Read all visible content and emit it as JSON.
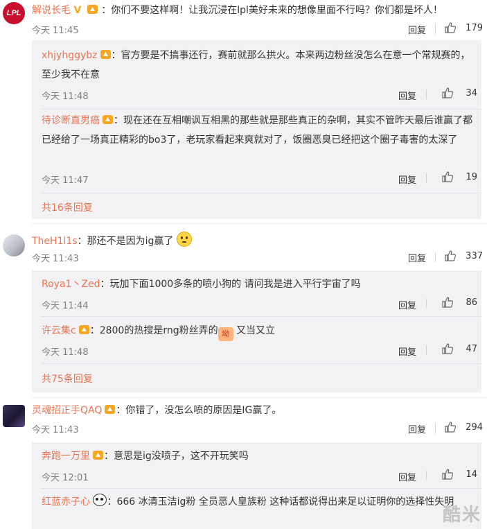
{
  "comments": [
    {
      "username": "解说长毛",
      "verified": "V",
      "text": "：你们不要这样啊！让我沉浸在lpl美好未来的想像里面不行吗？你们都是坏人！",
      "time": "今天 11:45",
      "reply_label": "回复",
      "likes": "179",
      "replies": [
        {
          "username": "xhjyhggybz",
          "text": "：官方要是不搞事还行，赛前就那么拱火。本来两边粉丝没怎么在意一个常规赛的，至少我不在意",
          "time": "今天 11:48",
          "reply_label": "回复",
          "likes": "34"
        },
        {
          "username": "待诊断直男癌",
          "text": "：现在还在互相嘲讽互相黑的那些就是那些真正的杂啊，其实不管昨天最后谁赢了都已经给了一场真正精彩的bo3了，老玩家看起来爽就对了，饭圈恶臭已经把这个圈子毒害的太深了",
          "time": "今天 11:47",
          "reply_label": "回复",
          "likes": "19"
        }
      ],
      "more": "共16条回复"
    },
    {
      "username": "TheH1l1s",
      "text": "：那还不是因为ig赢了",
      "time": "今天 11:43",
      "reply_label": "回复",
      "likes": "337",
      "replies": [
        {
          "username": "Roya1丶Zed",
          "text": "：玩加下面1000多条的喷小狗的 请问我是进入平行宇宙了吗",
          "time": "今天 11:44",
          "reply_label": "回复",
          "likes": "86"
        },
        {
          "username": "许云集c",
          "text": "：2800的热搜是rng粉丝弄的",
          "text_after": "又当又立",
          "sticker": "坳",
          "time": "今天 11:48",
          "reply_label": "回复",
          "likes": "47"
        }
      ],
      "more": "共75条回复"
    },
    {
      "username": "灵魂招正手QAQ",
      "text": "：你错了，没怎么喷的原因是IG赢了。",
      "time": "今天 11:43",
      "reply_label": "回复",
      "likes": "294",
      "replies": [
        {
          "username": "奔跑一万里",
          "text": "：意思是ig没喷子，这不开玩笑吗",
          "time": "今天 12:01",
          "reply_label": "回复",
          "likes": "14"
        },
        {
          "username": "红蓝赤子心",
          "text": "：666 冰清玉洁ig粉 全员恶人皇族粉 这种话都说得出来足以证明你的选择性失明"
        }
      ]
    }
  ],
  "avatars": {
    "first": "LPL"
  },
  "watermark": "酷米",
  "colors": {
    "username": "#eb7350",
    "reply_bg": "#f2f2f5",
    "medal": "#f5a623"
  },
  "icons": {
    "like": "thumbs-up-icon",
    "medal": "fan-medal-icon",
    "vip": "vip-v-icon"
  }
}
